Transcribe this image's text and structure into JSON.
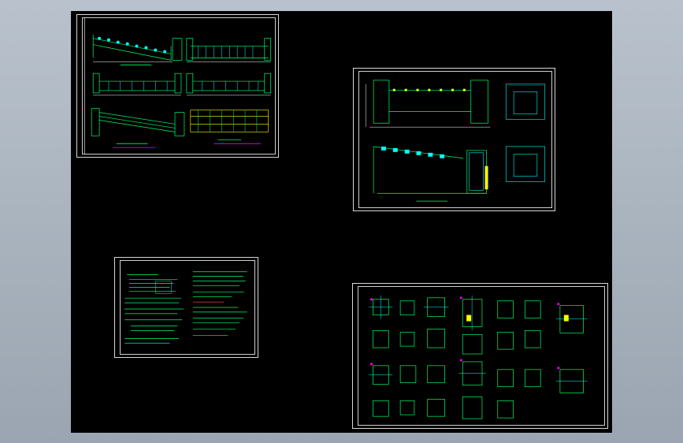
{
  "window": {
    "background": "#000000",
    "frame_gradient": [
      "#b9c2cc",
      "#9aa5b1"
    ]
  },
  "sheets": [
    {
      "id": "sheet-elevations",
      "label": "",
      "color_primary": "#00ff66",
      "color_secondary": "#00ffff",
      "accent": "#ff00ff"
    },
    {
      "id": "sheet-sections",
      "label": "",
      "color_primary": "#00ff66",
      "color_secondary": "#00ffff",
      "accent": "#ffff00"
    },
    {
      "id": "sheet-notes",
      "label": "",
      "color_primary": "#00ff66",
      "accent": "#ff3333"
    },
    {
      "id": "sheet-details",
      "label": "",
      "color_primary": "#00ff66",
      "color_secondary": "#00ffff",
      "accent": "#ff00ff"
    }
  ]
}
